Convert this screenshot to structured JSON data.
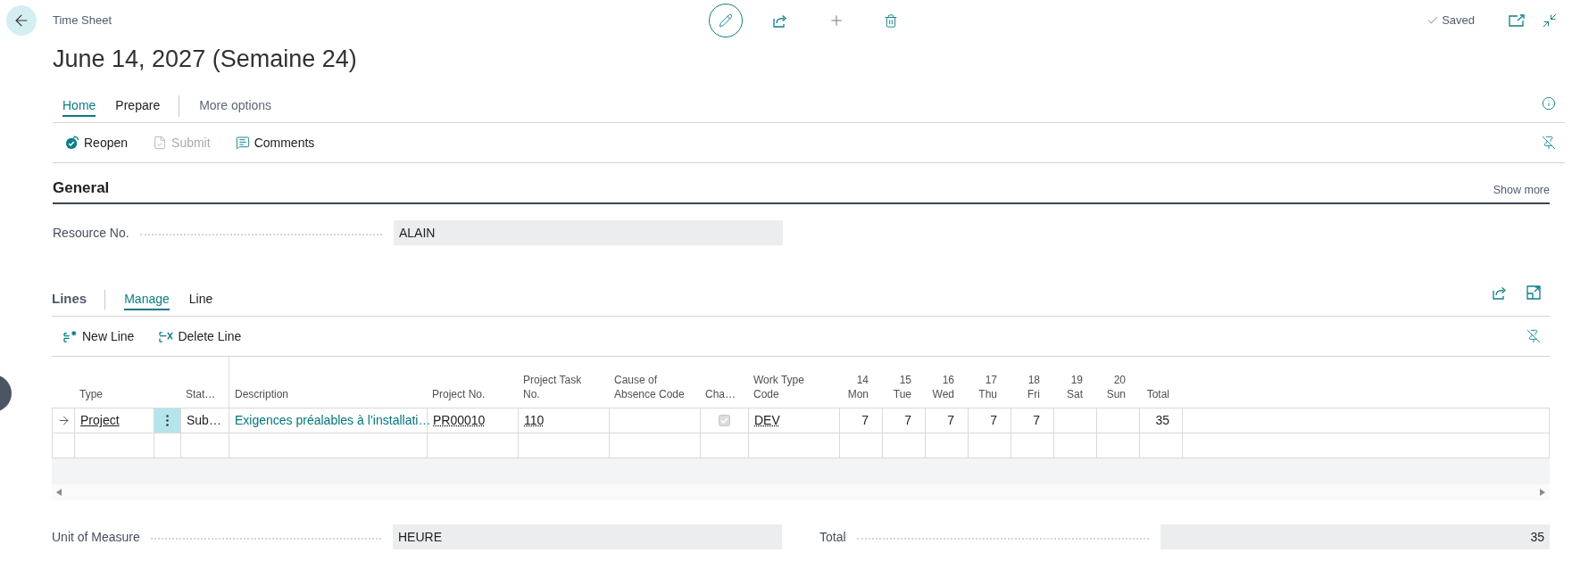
{
  "header": {
    "breadcrumb": "Time Sheet",
    "title": "June 14, 2027 (Semaine 24)",
    "save_status": "Saved"
  },
  "tabs": [
    {
      "label": "Home",
      "selected": true
    },
    {
      "label": "Prepare",
      "selected": false
    }
  ],
  "more_options": "More options",
  "actions": [
    {
      "kind": "reopen",
      "label": "Reopen",
      "disabled": false
    },
    {
      "kind": "submit",
      "label": "Submit",
      "disabled": true
    },
    {
      "kind": "comments",
      "label": "Comments",
      "disabled": false
    }
  ],
  "general": {
    "title": "General",
    "show_more": "Show more",
    "fields": [
      {
        "label": "Resource No.",
        "value": "ALAIN",
        "kind": "text"
      }
    ]
  },
  "lines": {
    "title": "Lines",
    "tabs": [
      {
        "label": "Manage",
        "selected": true
      },
      {
        "label": "Line",
        "selected": false
      }
    ],
    "actions": [
      {
        "kind": "new",
        "label": "New Line"
      },
      {
        "kind": "delete",
        "label": "Delete Line"
      }
    ],
    "table": {
      "columns": [
        {
          "label": "Type"
        },
        {
          "label": "Stat…"
        },
        {
          "label": "Description"
        },
        {
          "label": "Project No."
        },
        {
          "label": "Project Task No."
        },
        {
          "label": "Cause of Absence Code"
        },
        {
          "label": "Cha…"
        },
        {
          "label": "Work Type Code"
        }
      ],
      "days": [
        {
          "day": "14",
          "weekday": "Mon"
        },
        {
          "day": "15",
          "weekday": "Tue"
        },
        {
          "day": "16",
          "weekday": "Wed"
        },
        {
          "day": "17",
          "weekday": "Thu"
        },
        {
          "day": "18",
          "weekday": "Fri"
        },
        {
          "day": "19",
          "weekday": "Sat"
        },
        {
          "day": "20",
          "weekday": "Sun"
        }
      ],
      "total_label": "Total",
      "rows": [
        {
          "current": true,
          "type": "Project",
          "status": "Sub…",
          "description": "Exigences préalables à l’installati…",
          "project_no": "PR00010",
          "project_task_no": "110",
          "cha_checked": true,
          "work_type_code": "DEV",
          "hours": [
            "7",
            "7",
            "7",
            "7",
            "7"
          ],
          "total": "35"
        },
        {
          "current": false
        }
      ]
    }
  },
  "footer": {
    "fields": [
      {
        "label": "Unit of Measure",
        "value": "HEURE",
        "kind": "text"
      },
      {
        "label": "Total",
        "value": "35",
        "kind": "number"
      }
    ]
  }
}
